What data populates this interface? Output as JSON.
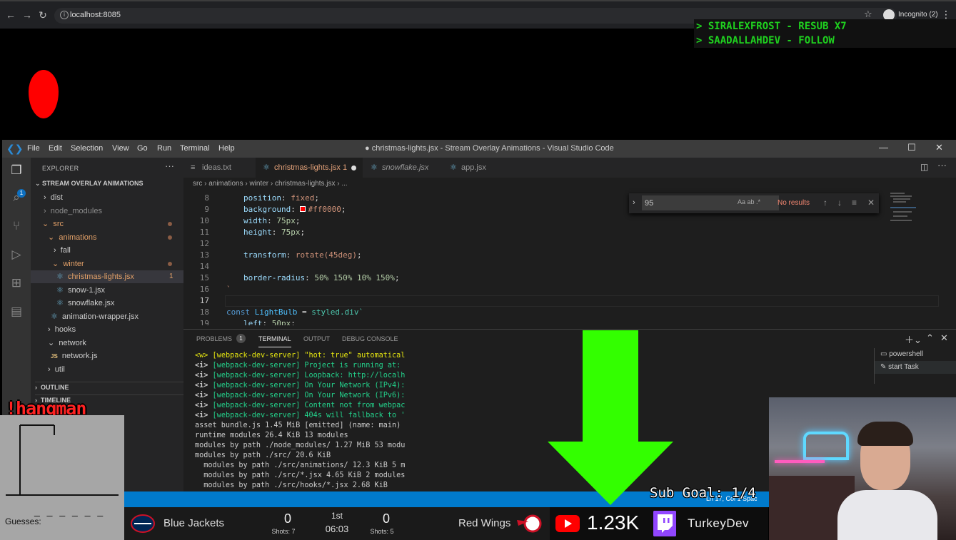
{
  "browser": {
    "url": "localhost:8085",
    "incognito_label": "Incognito (2)"
  },
  "alerts": {
    "lines": [
      "> SIRALEXFROST - RESUB X7",
      "> SAADALLAHDEV - FOLLOW"
    ]
  },
  "vscode": {
    "menu": [
      "File",
      "Edit",
      "Selection",
      "View",
      "Go",
      "Run",
      "Terminal",
      "Help"
    ],
    "window_title": "● christmas-lights.jsx - Stream Overlay Animations - Visual Studio Code",
    "explorer_title": "EXPLORER",
    "project_title": "STREAM OVERLAY ANIMATIONS",
    "tree": [
      {
        "label": "dist",
        "arrow": "›"
      },
      {
        "label": "node_modules",
        "arrow": "›"
      },
      {
        "label": "src",
        "arrow": "⌄"
      },
      {
        "label": "animations",
        "arrow": "⌄"
      },
      {
        "label": "fall",
        "arrow": "›"
      },
      {
        "label": "winter",
        "arrow": "⌄"
      },
      {
        "label": "christmas-lights.jsx",
        "count": "1"
      },
      {
        "label": "snow-1.jsx"
      },
      {
        "label": "snowflake.jsx"
      },
      {
        "label": "animation-wrapper.jsx"
      },
      {
        "label": "hooks",
        "arrow": "›"
      },
      {
        "label": "network",
        "arrow": "⌄"
      },
      {
        "label": "network.js",
        "prefix": "JS"
      },
      {
        "label": "util",
        "arrow": "›"
      }
    ],
    "outline": "OUTLINE",
    "timeline": "TIMELINE",
    "tabs": [
      "ideas.txt",
      "christmas-lights.jsx 1",
      "snowflake.jsx",
      "app.jsx"
    ],
    "breadcrumb": "src › animations › winter › christmas-lights.jsx › ...",
    "find": {
      "query": "95",
      "toggles": "Aa  ab  .*",
      "result": "No results"
    },
    "code": {
      "line_numbers": [
        "8",
        "9",
        "10",
        "11",
        "12",
        "13",
        "14",
        "15",
        "16",
        "17",
        "18",
        "19"
      ],
      "l8_prop": "position",
      "l8_val": "fixed",
      "l9_prop": "background",
      "l9_val": "#ff0000",
      "l10_prop": "width",
      "l10_val": "75px",
      "l11_prop": "height",
      "l11_val": "75px",
      "l13_prop": "transform",
      "l13_val": "rotate(45deg)",
      "l15_prop": "border-radius",
      "l15_val": "50% 150% 10% 150%",
      "l16": "`",
      "l18_kw": "const",
      "l18_name": "LightBulb",
      "l18_rest": "styled.div`",
      "l19_prop": "left",
      "l19_val": "50px"
    },
    "panel": {
      "tabs": [
        "PROBLEMS",
        "TERMINAL",
        "OUTPUT",
        "DEBUG CONSOLE"
      ],
      "problems_count": "1",
      "terminal_lines": [
        {
          "tag": "<w>",
          "text": "[webpack-dev-server] \"hot: true\" automatical",
          "kind": "w"
        },
        {
          "tag": "<i>",
          "text": "[webpack-dev-server] Project is running at:",
          "kind": "i"
        },
        {
          "tag": "<i>",
          "text": "[webpack-dev-server] Loopback: http://localh",
          "kind": "i"
        },
        {
          "tag": "<i>",
          "text": "[webpack-dev-server] On Your Network (IPv4):",
          "kind": "i"
        },
        {
          "tag": "<i>",
          "text": "[webpack-dev-server] On Your Network (IPv6):",
          "kind": "i"
        },
        {
          "tag": "<i>",
          "text": "[webpack-dev-server] Content not from webpac",
          "kind": "i"
        },
        {
          "tag": "<i>",
          "text": "[webpack-dev-server] 404s will fallback to '",
          "kind": "i"
        },
        {
          "tag": "",
          "text": "asset bundle.js 1.45 MiB [emitted] (name: main)",
          "kind": "p"
        },
        {
          "tag": "",
          "text": "runtime modules 26.4 KiB 13 modules",
          "kind": "p"
        },
        {
          "tag": "",
          "text": "modules by path ./node_modules/ 1.27 MiB 53 modu",
          "kind": "p"
        },
        {
          "tag": "",
          "text": "modules by path ./src/ 20.6 KiB",
          "kind": "p"
        },
        {
          "tag": "",
          "text": "  modules by path ./src/animations/ 12.3 KiB 5 m",
          "kind": "p"
        },
        {
          "tag": "",
          "text": "  modules by path ./src/*.jsx 4.65 KiB 2 modules",
          "kind": "p"
        },
        {
          "tag": "",
          "text": "  modules by path ./src/hooks/*.jsx 2.68 KiB",
          "kind": "p"
        }
      ],
      "terminals": [
        "powershell",
        "start  Task"
      ]
    },
    "status_position": "Ln 17, Col 1  Spac"
  },
  "hangman": {
    "command": "!hangman",
    "word": "_ _ _ _ _ _",
    "guesses_label": "Guesses:"
  },
  "scoreboard": {
    "home_team": "Blue Jackets",
    "home_score": "0",
    "home_shots": "Shots: 7",
    "period": "1st",
    "clock": "06:03",
    "away_score": "0",
    "away_shots": "Shots: 5",
    "away_team": "Red Wings"
  },
  "youtube": {
    "count": "1.23K"
  },
  "twitch": {
    "name": "TurkeyDev"
  },
  "sub_goal": "Sub Goal: 1/4",
  "colors": {
    "alert_text": "#1fd11f",
    "bulb": "#ff0000",
    "arrow": "#33ff00",
    "statusbar": "#007acc",
    "twitch": "#9146ff",
    "youtube": "#ff0000"
  },
  "icons": {
    "back": "arrow-left-icon",
    "forward": "arrow-right-icon",
    "reload": "reload-icon",
    "explorer": "files-icon",
    "search": "search-icon",
    "scm": "source-control-icon",
    "debug": "run-debug-icon",
    "extensions": "extensions-icon"
  }
}
